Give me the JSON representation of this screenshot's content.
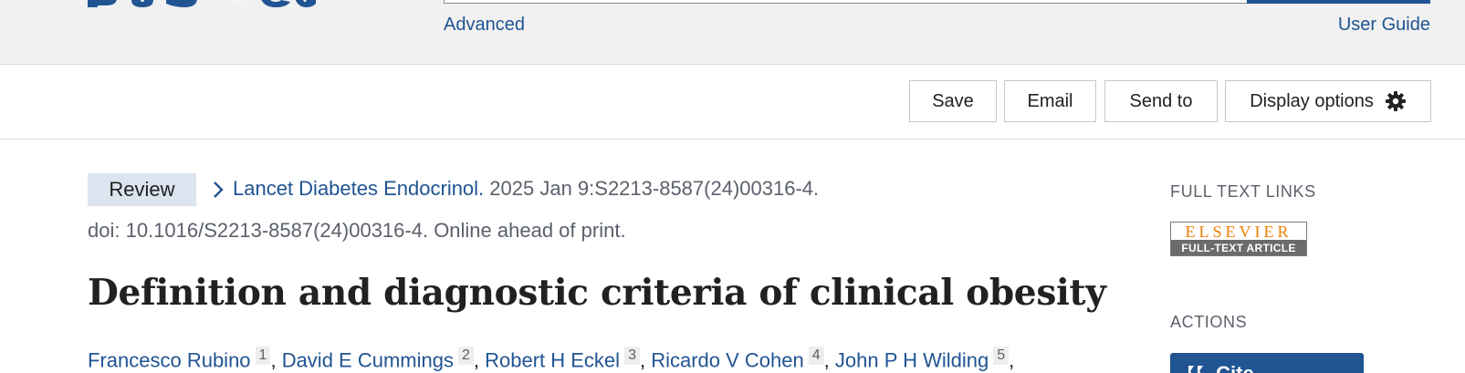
{
  "header": {
    "logo_text": "PubMed",
    "advanced_label": "Advanced",
    "user_guide_label": "User Guide"
  },
  "actions_bar": {
    "save_label": "Save",
    "email_label": "Email",
    "send_to_label": "Send to",
    "display_options_label": "Display options",
    "display_options_icon": "gear-icon"
  },
  "article": {
    "type_tag": "Review",
    "journal": "Lancet Diabetes Endocrinol.",
    "citation_rest": " 2025 Jan 9:S2213-8587(24)00316-4.",
    "doi_line": "doi: 10.1016/S2213-8587(24)00316-4. Online ahead of print.",
    "title": "Definition and diagnostic criteria of clinical obesity",
    "authors": [
      {
        "name": "Francesco Rubino",
        "aff": "1"
      },
      {
        "name": "David E Cummings",
        "aff": "2"
      },
      {
        "name": "Robert H Eckel",
        "aff": "3"
      },
      {
        "name": "Ricardo V Cohen",
        "aff": "4"
      },
      {
        "name": "John P H Wilding",
        "aff": "5"
      }
    ],
    "author_separator": ", ",
    "author_trailing": ","
  },
  "sidebar": {
    "full_text_heading": "FULL TEXT LINKS",
    "elsevier_top": "ELSEVIER",
    "elsevier_bottom": "FULL-TEXT ARTICLE",
    "actions_heading": "ACTIONS",
    "cite_label": "Cite",
    "cite_icon": "quote-icon"
  },
  "colors": {
    "link_blue": "#205493",
    "header_bg": "#f1f1f1",
    "tag_bg": "#dce4ef",
    "elsevier_orange": "#f07d00"
  }
}
